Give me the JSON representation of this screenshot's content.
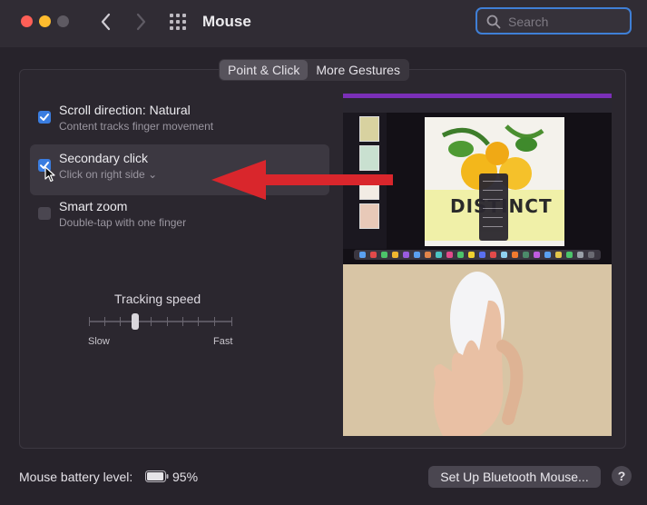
{
  "window": {
    "title": "Mouse",
    "search_placeholder": "Search",
    "icons": {
      "back": "chevron-left-icon",
      "forward": "chevron-right-icon",
      "show_all": "grid-icon",
      "search": "search-icon"
    }
  },
  "tabs": [
    {
      "label": "Point & Click",
      "active": true
    },
    {
      "label": "More Gestures",
      "active": false
    }
  ],
  "options": [
    {
      "label": "Scroll direction: Natural",
      "sublabel": "Content tracks finger movement",
      "checked": true
    },
    {
      "label": "Secondary click",
      "sublabel": "Click on right side",
      "sublabel_caret": "⌄",
      "checked": true
    },
    {
      "label": "Smart zoom",
      "sublabel": "Double-tap with one finger",
      "checked": false
    }
  ],
  "tracking": {
    "label": "Tracking speed",
    "min_label": "Slow",
    "max_label": "Fast",
    "level": 0.32
  },
  "preview": {
    "page_title": "DISTINCT"
  },
  "footer": {
    "battery_label": "Mouse battery level:",
    "battery_percent": "95%",
    "battery_level": 0.95,
    "setup_button": "Set Up Bluetooth Mouse...",
    "help_button": "?"
  },
  "colors": {
    "accent": "#3a7de0",
    "annotation_arrow": "#d9262c"
  }
}
